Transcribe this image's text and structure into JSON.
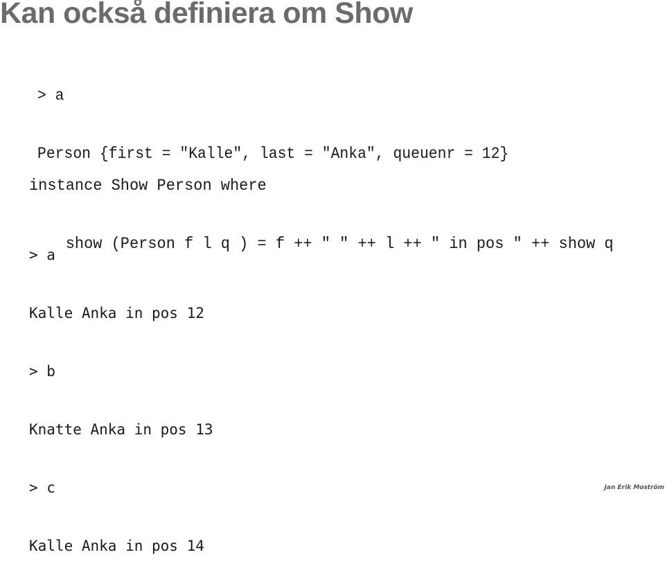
{
  "slide": {
    "title": "Kan också definiera om Show",
    "repl_before": [
      "> a",
      "Person {first = \"Kalle\", last = \"Anka\", queuenr = 12}"
    ],
    "instance_code": [
      "instance Show Person where",
      "    show (Person f l q ) = f ++ \" \" ++ l ++ \" in pos \" ++ show q"
    ],
    "repl_after": [
      "> a",
      "Kalle Anka in pos 12",
      "> b",
      "Knatte Anka in pos 13",
      "> c",
      "Kalle Anka in pos 14"
    ],
    "author": "Jan Erik Moström"
  }
}
